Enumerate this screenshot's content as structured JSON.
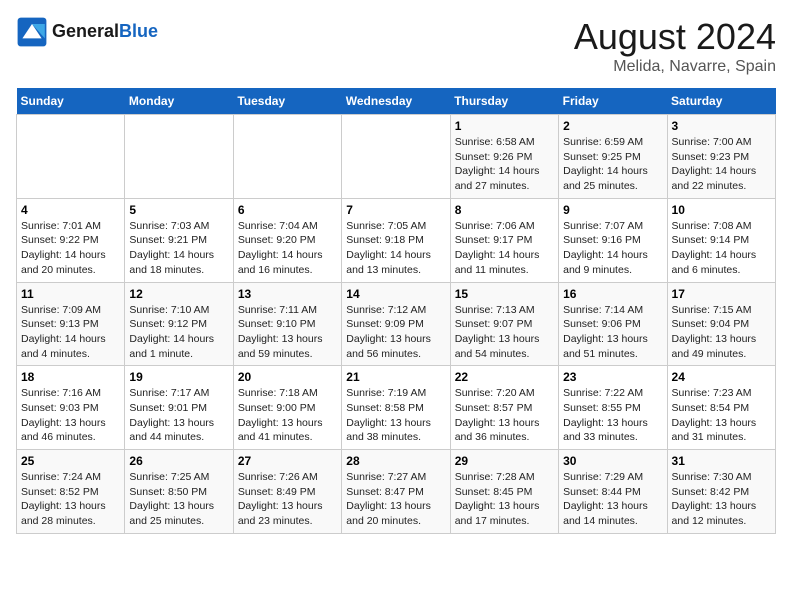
{
  "header": {
    "logo_line1": "General",
    "logo_line2": "Blue",
    "month_title": "August 2024",
    "location": "Melida, Navarre, Spain"
  },
  "days_of_week": [
    "Sunday",
    "Monday",
    "Tuesday",
    "Wednesday",
    "Thursday",
    "Friday",
    "Saturday"
  ],
  "weeks": [
    [
      {
        "day": "",
        "info": ""
      },
      {
        "day": "",
        "info": ""
      },
      {
        "day": "",
        "info": ""
      },
      {
        "day": "",
        "info": ""
      },
      {
        "day": "1",
        "info": "Sunrise: 6:58 AM\nSunset: 9:26 PM\nDaylight: 14 hours\nand 27 minutes."
      },
      {
        "day": "2",
        "info": "Sunrise: 6:59 AM\nSunset: 9:25 PM\nDaylight: 14 hours\nand 25 minutes."
      },
      {
        "day": "3",
        "info": "Sunrise: 7:00 AM\nSunset: 9:23 PM\nDaylight: 14 hours\nand 22 minutes."
      }
    ],
    [
      {
        "day": "4",
        "info": "Sunrise: 7:01 AM\nSunset: 9:22 PM\nDaylight: 14 hours\nand 20 minutes."
      },
      {
        "day": "5",
        "info": "Sunrise: 7:03 AM\nSunset: 9:21 PM\nDaylight: 14 hours\nand 18 minutes."
      },
      {
        "day": "6",
        "info": "Sunrise: 7:04 AM\nSunset: 9:20 PM\nDaylight: 14 hours\nand 16 minutes."
      },
      {
        "day": "7",
        "info": "Sunrise: 7:05 AM\nSunset: 9:18 PM\nDaylight: 14 hours\nand 13 minutes."
      },
      {
        "day": "8",
        "info": "Sunrise: 7:06 AM\nSunset: 9:17 PM\nDaylight: 14 hours\nand 11 minutes."
      },
      {
        "day": "9",
        "info": "Sunrise: 7:07 AM\nSunset: 9:16 PM\nDaylight: 14 hours\nand 9 minutes."
      },
      {
        "day": "10",
        "info": "Sunrise: 7:08 AM\nSunset: 9:14 PM\nDaylight: 14 hours\nand 6 minutes."
      }
    ],
    [
      {
        "day": "11",
        "info": "Sunrise: 7:09 AM\nSunset: 9:13 PM\nDaylight: 14 hours\nand 4 minutes."
      },
      {
        "day": "12",
        "info": "Sunrise: 7:10 AM\nSunset: 9:12 PM\nDaylight: 14 hours\nand 1 minute."
      },
      {
        "day": "13",
        "info": "Sunrise: 7:11 AM\nSunset: 9:10 PM\nDaylight: 13 hours\nand 59 minutes."
      },
      {
        "day": "14",
        "info": "Sunrise: 7:12 AM\nSunset: 9:09 PM\nDaylight: 13 hours\nand 56 minutes."
      },
      {
        "day": "15",
        "info": "Sunrise: 7:13 AM\nSunset: 9:07 PM\nDaylight: 13 hours\nand 54 minutes."
      },
      {
        "day": "16",
        "info": "Sunrise: 7:14 AM\nSunset: 9:06 PM\nDaylight: 13 hours\nand 51 minutes."
      },
      {
        "day": "17",
        "info": "Sunrise: 7:15 AM\nSunset: 9:04 PM\nDaylight: 13 hours\nand 49 minutes."
      }
    ],
    [
      {
        "day": "18",
        "info": "Sunrise: 7:16 AM\nSunset: 9:03 PM\nDaylight: 13 hours\nand 46 minutes."
      },
      {
        "day": "19",
        "info": "Sunrise: 7:17 AM\nSunset: 9:01 PM\nDaylight: 13 hours\nand 44 minutes."
      },
      {
        "day": "20",
        "info": "Sunrise: 7:18 AM\nSunset: 9:00 PM\nDaylight: 13 hours\nand 41 minutes."
      },
      {
        "day": "21",
        "info": "Sunrise: 7:19 AM\nSunset: 8:58 PM\nDaylight: 13 hours\nand 38 minutes."
      },
      {
        "day": "22",
        "info": "Sunrise: 7:20 AM\nSunset: 8:57 PM\nDaylight: 13 hours\nand 36 minutes."
      },
      {
        "day": "23",
        "info": "Sunrise: 7:22 AM\nSunset: 8:55 PM\nDaylight: 13 hours\nand 33 minutes."
      },
      {
        "day": "24",
        "info": "Sunrise: 7:23 AM\nSunset: 8:54 PM\nDaylight: 13 hours\nand 31 minutes."
      }
    ],
    [
      {
        "day": "25",
        "info": "Sunrise: 7:24 AM\nSunset: 8:52 PM\nDaylight: 13 hours\nand 28 minutes."
      },
      {
        "day": "26",
        "info": "Sunrise: 7:25 AM\nSunset: 8:50 PM\nDaylight: 13 hours\nand 25 minutes."
      },
      {
        "day": "27",
        "info": "Sunrise: 7:26 AM\nSunset: 8:49 PM\nDaylight: 13 hours\nand 23 minutes."
      },
      {
        "day": "28",
        "info": "Sunrise: 7:27 AM\nSunset: 8:47 PM\nDaylight: 13 hours\nand 20 minutes."
      },
      {
        "day": "29",
        "info": "Sunrise: 7:28 AM\nSunset: 8:45 PM\nDaylight: 13 hours\nand 17 minutes."
      },
      {
        "day": "30",
        "info": "Sunrise: 7:29 AM\nSunset: 8:44 PM\nDaylight: 13 hours\nand 14 minutes."
      },
      {
        "day": "31",
        "info": "Sunrise: 7:30 AM\nSunset: 8:42 PM\nDaylight: 13 hours\nand 12 minutes."
      }
    ]
  ]
}
